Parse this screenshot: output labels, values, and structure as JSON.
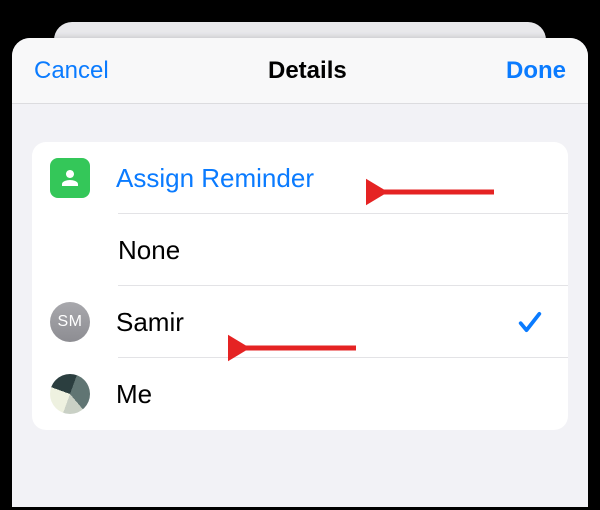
{
  "nav": {
    "cancel": "Cancel",
    "title": "Details",
    "done": "Done"
  },
  "assign": {
    "header_label": "Assign Reminder",
    "options": [
      {
        "label": "None",
        "avatar_type": "none",
        "initials": "",
        "selected": false
      },
      {
        "label": "Samir",
        "avatar_type": "initials",
        "initials": "SM",
        "selected": true
      },
      {
        "label": "Me",
        "avatar_type": "photo",
        "initials": "",
        "selected": false
      }
    ]
  },
  "colors": {
    "accent": "#0a7bff",
    "green": "#34c759",
    "annotation": "#e52323"
  }
}
